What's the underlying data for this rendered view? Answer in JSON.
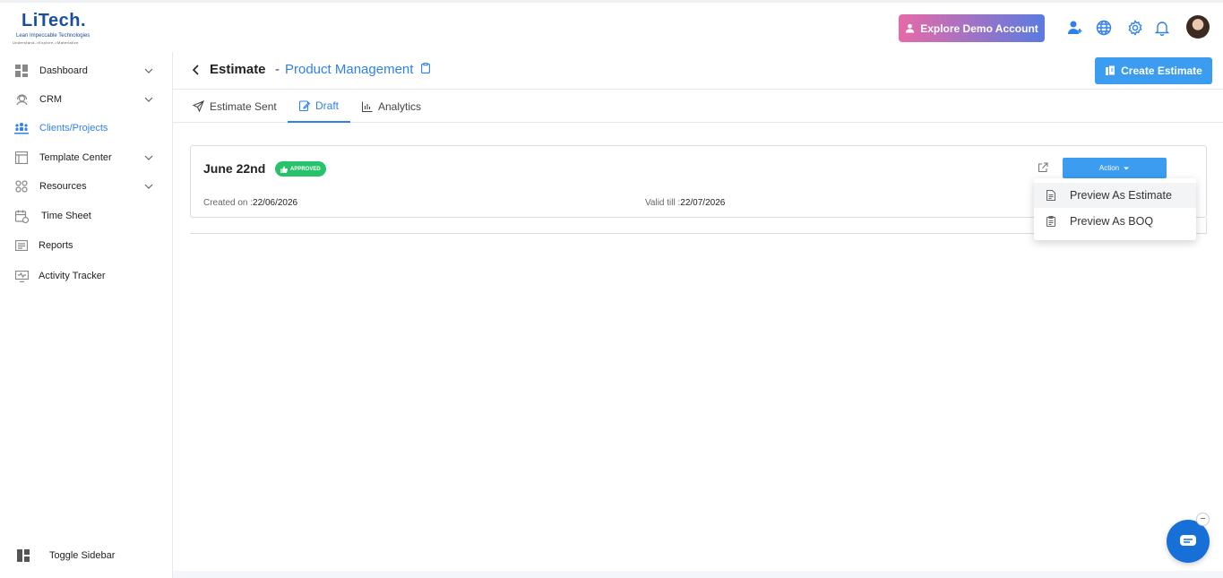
{
  "brand": {
    "name": "LiTech.",
    "tagline": "Lean Impeccable Technologies",
    "motto": "Understand->Explore->Materialize",
    "color": "#1a4fa0"
  },
  "header": {
    "demo_label": "Explore Demo Account"
  },
  "sidebar": {
    "items": [
      {
        "label": "Dashboard",
        "icon": "grid-icon",
        "expandable": true
      },
      {
        "label": "CRM",
        "icon": "headset-icon",
        "expandable": true
      },
      {
        "label": "Clients/Projects",
        "icon": "people-icon",
        "expandable": false,
        "active": true
      },
      {
        "label": "Template Center",
        "icon": "template-icon",
        "expandable": true
      },
      {
        "label": "Resources",
        "icon": "resources-icon",
        "expandable": true
      },
      {
        "label": "Time Sheet",
        "icon": "calendar-icon",
        "expandable": false
      },
      {
        "label": "Reports",
        "icon": "reports-icon",
        "expandable": false
      },
      {
        "label": "Activity Tracker",
        "icon": "monitor-icon",
        "expandable": false
      }
    ],
    "toggle_label": "Toggle Sidebar"
  },
  "page": {
    "title": "Estimate",
    "separator": "-",
    "subtitle": "Product Management",
    "create_label": "Create Estimate"
  },
  "tabs": [
    {
      "label": "Estimate Sent",
      "icon": "send-icon",
      "active": false
    },
    {
      "label": "Draft",
      "icon": "edit-icon",
      "active": true
    },
    {
      "label": "Analytics",
      "icon": "bar-chart-icon",
      "active": false
    }
  ],
  "card": {
    "title": "June 22nd",
    "badge": "APPROVED",
    "created_label": "Created on :",
    "created_value": "22/06/2026",
    "valid_label": "Valid till :",
    "valid_value": "22/07/2026",
    "action_label": "Action"
  },
  "dropdown": [
    {
      "label": "Preview As Estimate"
    },
    {
      "label": "Preview As BOQ"
    }
  ],
  "chat": {
    "minimize_label": "−"
  },
  "colors": {
    "accent": "#2f80ed",
    "button": "#3b9cf0",
    "success": "#27c36a"
  }
}
